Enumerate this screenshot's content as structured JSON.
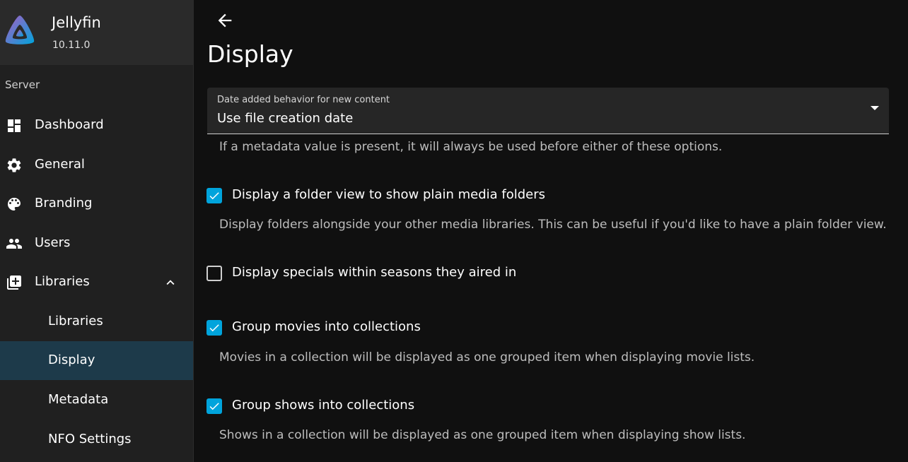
{
  "app": {
    "name": "Jellyfin",
    "version": "10.11.0"
  },
  "sidebar": {
    "section_label": "Server",
    "items": [
      {
        "label": "Dashboard",
        "icon": "dashboard-icon"
      },
      {
        "label": "General",
        "icon": "gear-icon"
      },
      {
        "label": "Branding",
        "icon": "palette-icon"
      },
      {
        "label": "Users",
        "icon": "users-icon"
      },
      {
        "label": "Libraries",
        "icon": "library-add-icon",
        "expanded": true
      }
    ],
    "sub_items": [
      {
        "label": "Libraries",
        "active": false
      },
      {
        "label": "Display",
        "active": true
      },
      {
        "label": "Metadata",
        "active": false
      },
      {
        "label": "NFO Settings",
        "active": false
      }
    ]
  },
  "main": {
    "title": "Display",
    "date_added": {
      "label": "Date added behavior for new content",
      "value": "Use file creation date",
      "helper": "If a metadata value is present, it will always be used before either of these options."
    },
    "options": [
      {
        "label": "Display a folder view to show plain media folders",
        "checked": true,
        "helper": "Display folders alongside your other media libraries. This can be useful if you'd like to have a plain folder view."
      },
      {
        "label": "Display specials within seasons they aired in",
        "checked": false,
        "helper": ""
      },
      {
        "label": "Group movies into collections",
        "checked": true,
        "helper": "Movies in a collection will be displayed as one grouped item when displaying movie lists."
      },
      {
        "label": "Group shows into collections",
        "checked": true,
        "helper": "Shows in a collection will be displayed as one grouped item when displaying show lists."
      }
    ]
  },
  "colors": {
    "accent": "#00a4dc",
    "active_nav_bg": "#1d3a4a",
    "sidebar_bg": "#202020",
    "main_bg": "#101010"
  }
}
